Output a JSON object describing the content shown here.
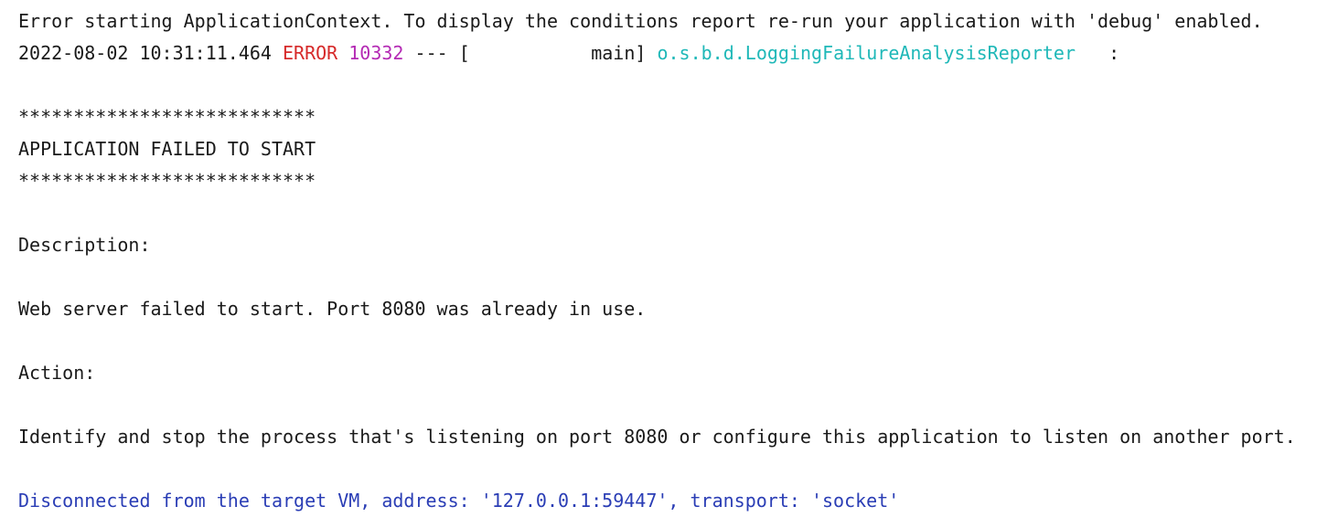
{
  "console": {
    "line1": "Error starting ApplicationContext. To display the conditions report re-run your application with 'debug' enabled.",
    "log": {
      "timestamp": "2022-08-02 10:31:11.464",
      "level": "ERROR",
      "pid": "10332",
      "separator": "---",
      "thread": "[           main]",
      "logger": "o.s.b.d.LoggingFailureAnalysisReporter",
      "colon": ":"
    },
    "stars_top": "***************************",
    "banner": "APPLICATION FAILED TO START",
    "stars_bottom": "***************************",
    "description_label": "Description:",
    "description_text": "Web server failed to start. Port 8080 was already in use.",
    "action_label": "Action:",
    "action_text": "Identify and stop the process that's listening on port 8080 or configure this application to listen on another port.",
    "disconnect": "Disconnected from the target VM, address: '127.0.0.1:59447', transport: 'socket'"
  },
  "colors": {
    "text": "#1a1a1a",
    "error": "#d62a2a",
    "pid": "#b42ab4",
    "logger": "#1fb8b8",
    "system": "#2a3db5"
  }
}
